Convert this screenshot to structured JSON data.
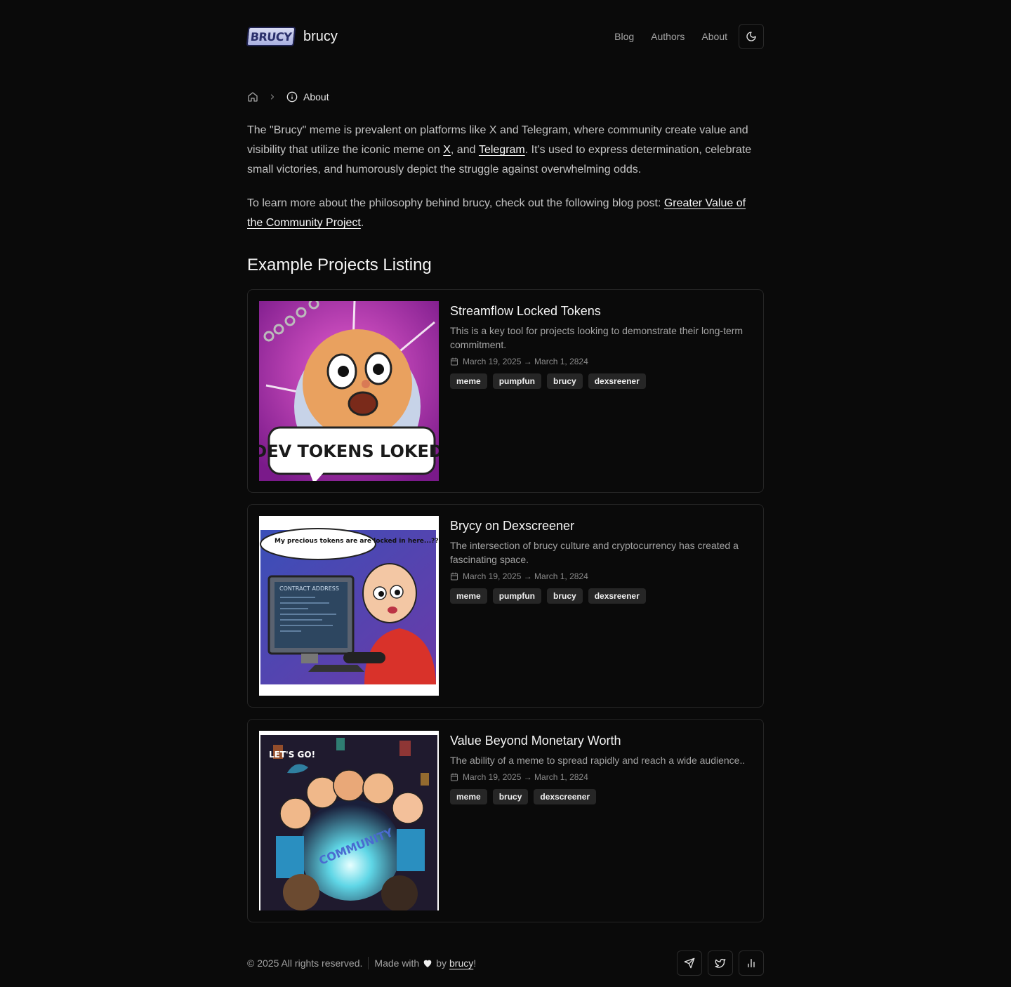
{
  "header": {
    "logo_text": "BRUCY",
    "brand": "brucy",
    "nav": [
      "Blog",
      "Authors",
      "About"
    ],
    "theme_icon": "moon-icon"
  },
  "breadcrumb": {
    "home_icon": "home-icon",
    "current": "About"
  },
  "intro": {
    "p1_a": "The \"Brucy\" meme is prevalent on platforms like X and Telegram, where community create value and visibility that utilize the iconic meme on ",
    "link_x": "X",
    "p1_b": ", and ",
    "link_telegram": "Telegram",
    "p1_c": ". It's used to express determination, celebrate small victories, and humorously depict the struggle against overwhelming odds.",
    "p2_a": "To learn more about the philosophy behind brucy, check out the following blog post: ",
    "link_blog": "Greater Value of the Community Project",
    "p2_b": "."
  },
  "section_title": "Example Projects Listing",
  "projects": [
    {
      "title": "Streamflow Locked Tokens",
      "desc": "This is a key tool for projects looking to demonstrate their long-term commitment.",
      "date": "March 19, 2025 → March 1, 2824",
      "tags": [
        "meme",
        "pumpfun",
        "brucy",
        "dexsreener"
      ],
      "image_caption": "DEV TOKENS LOKED!"
    },
    {
      "title": "Brycy on Dexscreener",
      "desc": "The intersection of brucy culture and cryptocurrency has created a fascinating space.",
      "date": "March 19, 2025 → March 1, 2824",
      "tags": [
        "meme",
        "pumpfun",
        "brucy",
        "dexsreener"
      ],
      "image_bubble": "My precious tokens are are locked in here...??",
      "image_screen": "CONTRACT ADDRESS"
    },
    {
      "title": "Value Beyond Monetary Worth",
      "desc": "The ability of a meme to spread rapidly and reach a wide audience..",
      "date": "March 19, 2025 → March 1, 2824",
      "tags": [
        "meme",
        "brucy",
        "dexscreener"
      ],
      "image_sign": "LET'S GO!",
      "image_orb": "COMMUNITY"
    }
  ],
  "footer": {
    "copyright": "© 2025 All rights reserved.",
    "made_with": "Made with",
    "by": "by",
    "link": "brucy",
    "excl": "!",
    "icons": [
      "send-icon",
      "twitter-icon",
      "bar-chart-icon"
    ]
  }
}
